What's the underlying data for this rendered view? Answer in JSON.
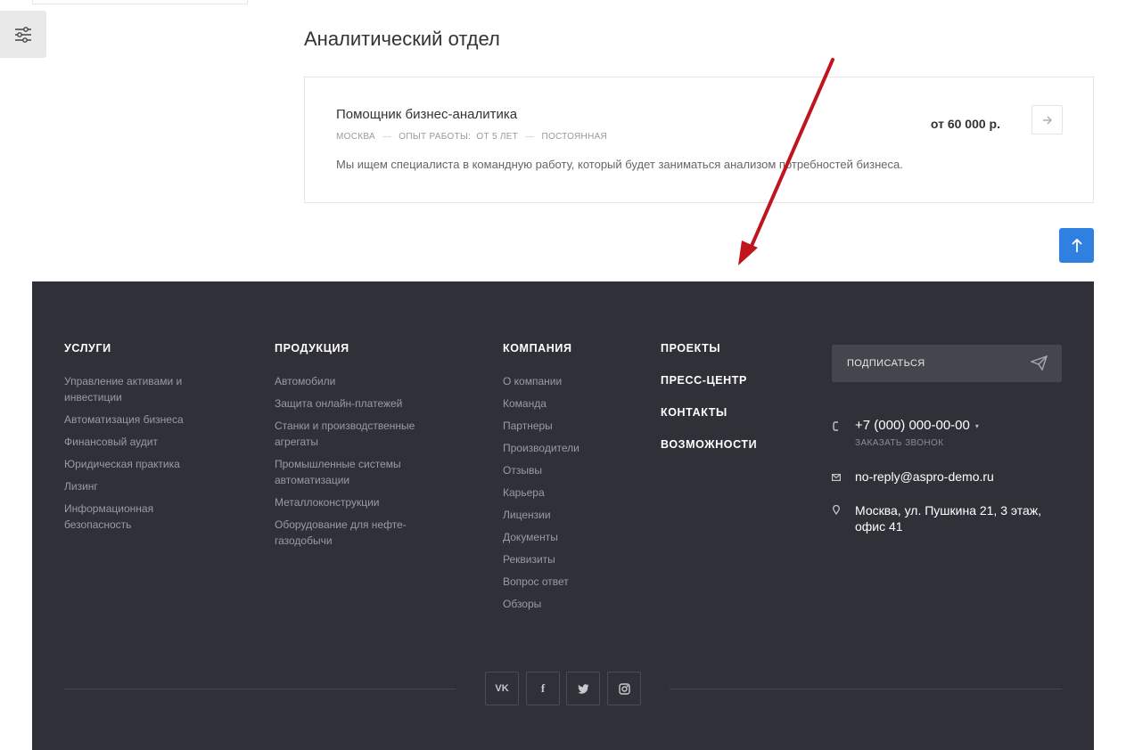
{
  "section": {
    "title": "Аналитический отдел"
  },
  "vacancy": {
    "title": "Помощник бизнес-аналитика",
    "city": "МОСКВА",
    "experience": "ОПЫТ РАБОТЫ:  ОТ 5 ЛЕТ",
    "employment": "ПОСТОЯННАЯ",
    "separator": "—",
    "description": "Мы ищем специалиста в командную работу, который будет заниматься анализом потребностей бизнеса.",
    "salary": "от 60 000 р."
  },
  "footer": {
    "services": {
      "title": "УСЛУГИ",
      "items": [
        "Управление активами и инвестиции",
        "Автоматизация бизнеса",
        "Финансовый аудит",
        "Юридическая практика",
        "Лизинг",
        "Информационная безопасность"
      ]
    },
    "products": {
      "title": "ПРОДУКЦИЯ",
      "items": [
        "Автомобили",
        "Защита онлайн-платежей",
        "Станки и производственные агрегаты",
        "Промышленные системы автоматизации",
        "Металлоконструкции",
        "Оборудование для нефте-газодобычи"
      ]
    },
    "company": {
      "title": "КОМПАНИЯ",
      "items": [
        "О компании",
        "Команда",
        "Партнеры",
        "Производители",
        "Отзывы",
        "Карьера",
        "Лицензии",
        "Документы",
        "Реквизиты",
        "Вопрос ответ",
        "Обзоры"
      ]
    },
    "links": [
      "ПРОЕКТЫ",
      "ПРЕСС-ЦЕНТР",
      "КОНТАКТЫ",
      "ВОЗМОЖНОСТИ"
    ],
    "subscribe_label": "ПОДПИСАТЬСЯ",
    "phone": "+7 (000) 000-00-00",
    "callback": "ЗАКАЗАТЬ ЗВОНОК",
    "email": "no-reply@aspro-demo.ru",
    "address": "Москва, ул. Пушкина 21, 3 этаж, офис 41",
    "social": {
      "vk": "VK",
      "facebook": "f"
    }
  },
  "colors": {
    "accent": "#2f80e0",
    "footer_bg": "#2f3038",
    "annotation": "#c0151f"
  }
}
